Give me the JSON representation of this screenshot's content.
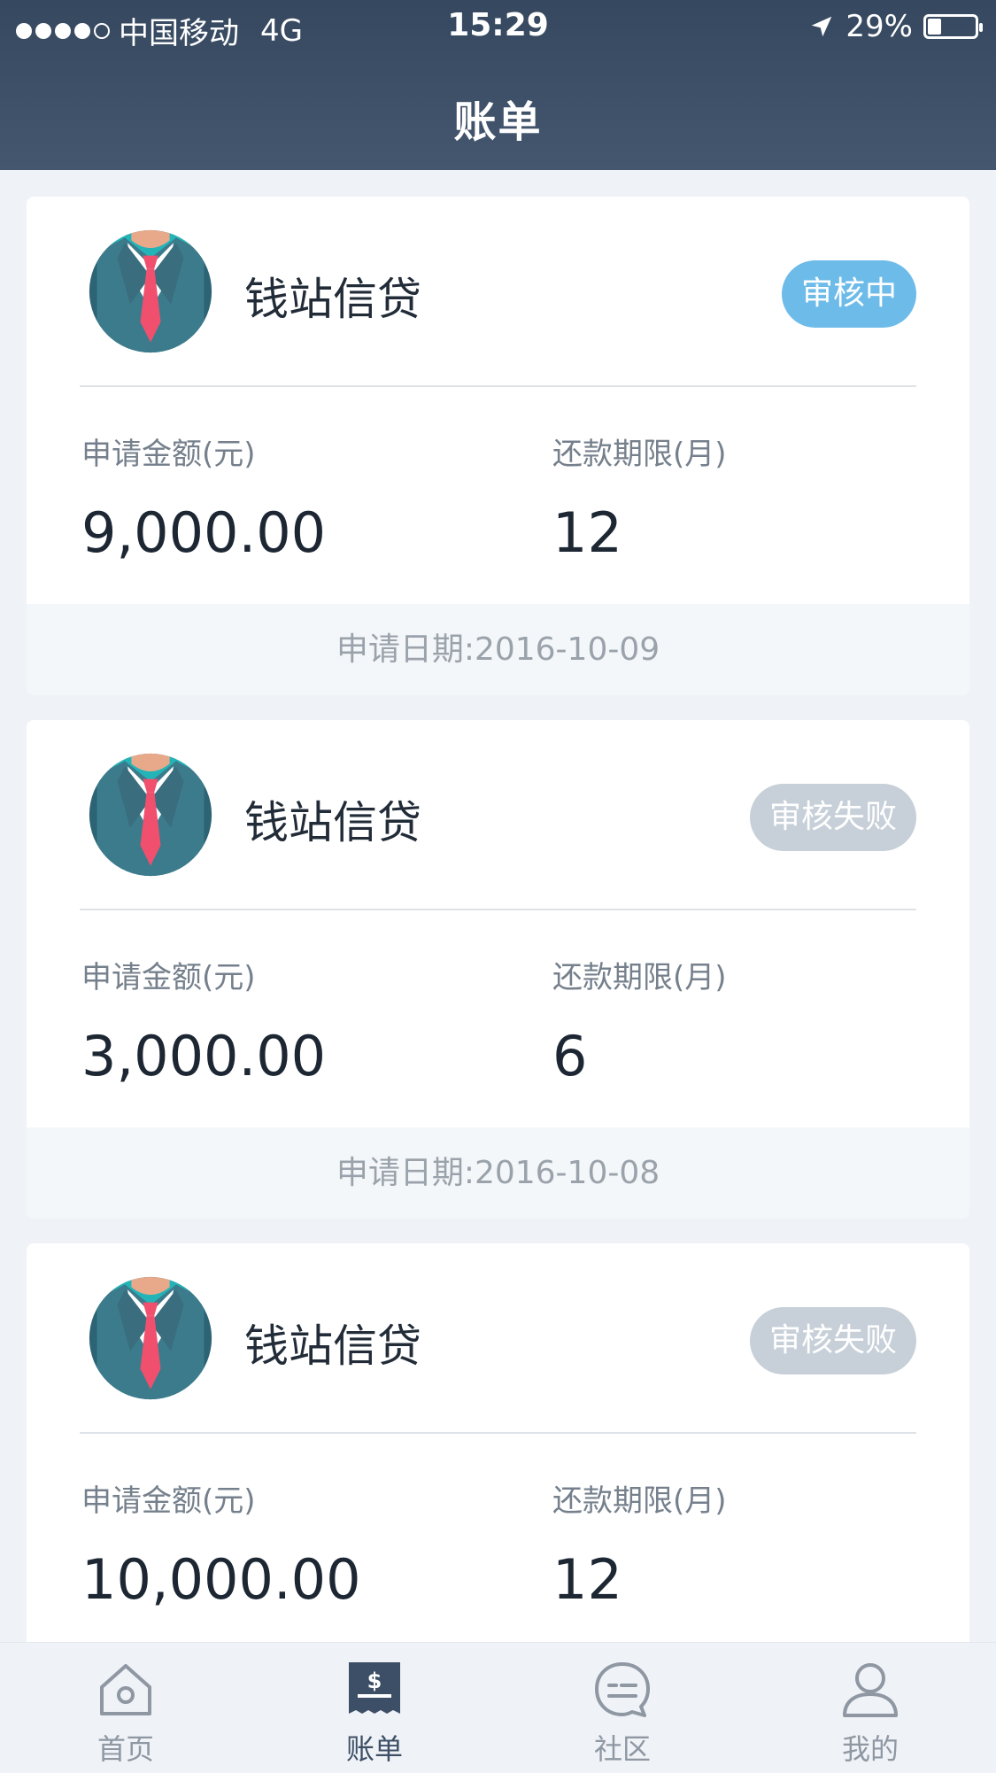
{
  "status_bar": {
    "carrier": "中国移动",
    "network": "4G",
    "time": "15:29",
    "battery": "29%",
    "battery_level": 0.29
  },
  "header": {
    "title": "账单"
  },
  "labels": {
    "amount": "申请金额(元)",
    "term": "还款期限(月)"
  },
  "cards": [
    {
      "lender": "钱站信贷",
      "status": "审核中",
      "status_color": "#6dbbe9",
      "amount": "9,000.00",
      "term": "12",
      "date": "申请日期:2016-10-09"
    },
    {
      "lender": "钱站信贷",
      "status": "审核失败",
      "status_color": "#c7d0d8",
      "amount": "3,000.00",
      "term": "6",
      "date": "申请日期:2016-10-08"
    },
    {
      "lender": "钱站信贷",
      "status": "审核失败",
      "status_color": "#c7d0d8",
      "amount": "10,000.00",
      "term": "12",
      "date": ""
    }
  ],
  "tabbar": {
    "items": [
      {
        "label": "首页",
        "icon": "home-icon"
      },
      {
        "label": "账单",
        "icon": "bill-icon",
        "active": true
      },
      {
        "label": "社区",
        "icon": "chat-icon"
      },
      {
        "label": "我的",
        "icon": "user-icon"
      }
    ]
  },
  "colors": {
    "header": "#3a4c63",
    "background": "#eff2f7",
    "badge_pending": "#6dbbe9",
    "badge_failed": "#c7d0d8",
    "active_tab": "#3d4f66"
  }
}
